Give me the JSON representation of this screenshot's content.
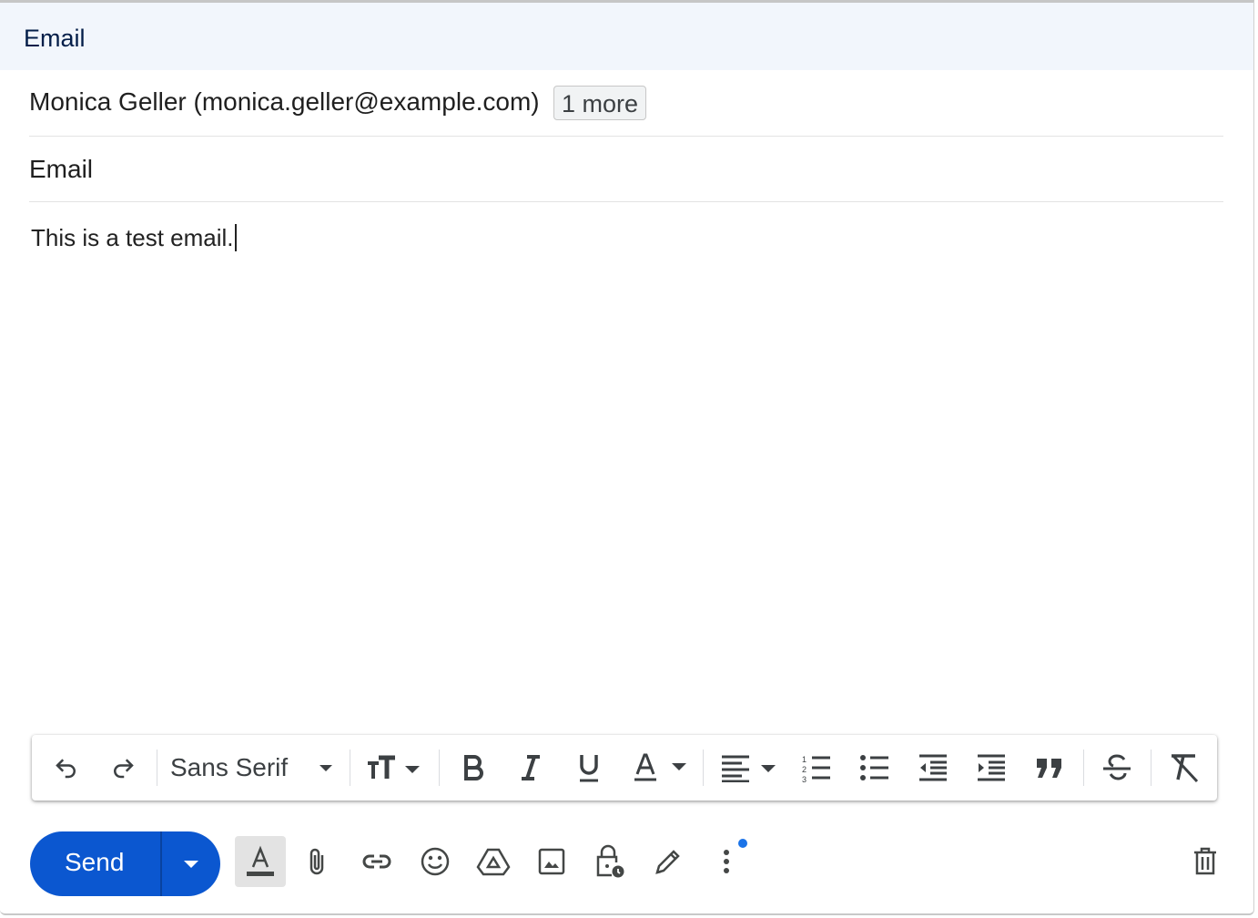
{
  "header": {
    "title": "Email"
  },
  "recipients": {
    "to": "Monica Geller (monica.geller@example.com)",
    "more": "1 more"
  },
  "subject": {
    "value": "Email"
  },
  "body": {
    "text": "This is a test email."
  },
  "format_bar": {
    "font": "Sans Serif",
    "items": [
      "undo-icon",
      "redo-icon",
      "font-dropdown",
      "text-size-icon",
      "bold-icon",
      "italic-icon",
      "underline-icon",
      "text-color-icon",
      "align-icon",
      "numbered-list-icon",
      "bulleted-list-icon",
      "indent-less-icon",
      "indent-more-icon",
      "quote-icon",
      "strikethrough-icon",
      "remove-formatting-icon"
    ]
  },
  "bottom_bar": {
    "send_label": "Send",
    "tools": [
      "formatting-options-icon",
      "attach-icon",
      "link-icon",
      "emoji-icon",
      "drive-icon",
      "photo-icon",
      "confidential-mode-icon",
      "signature-icon",
      "more-options-icon",
      "discard-icon"
    ]
  },
  "colors": {
    "send": "#0b57d0",
    "header_bg": "#f2f6fc",
    "notification_dot": "#1a73e8"
  }
}
